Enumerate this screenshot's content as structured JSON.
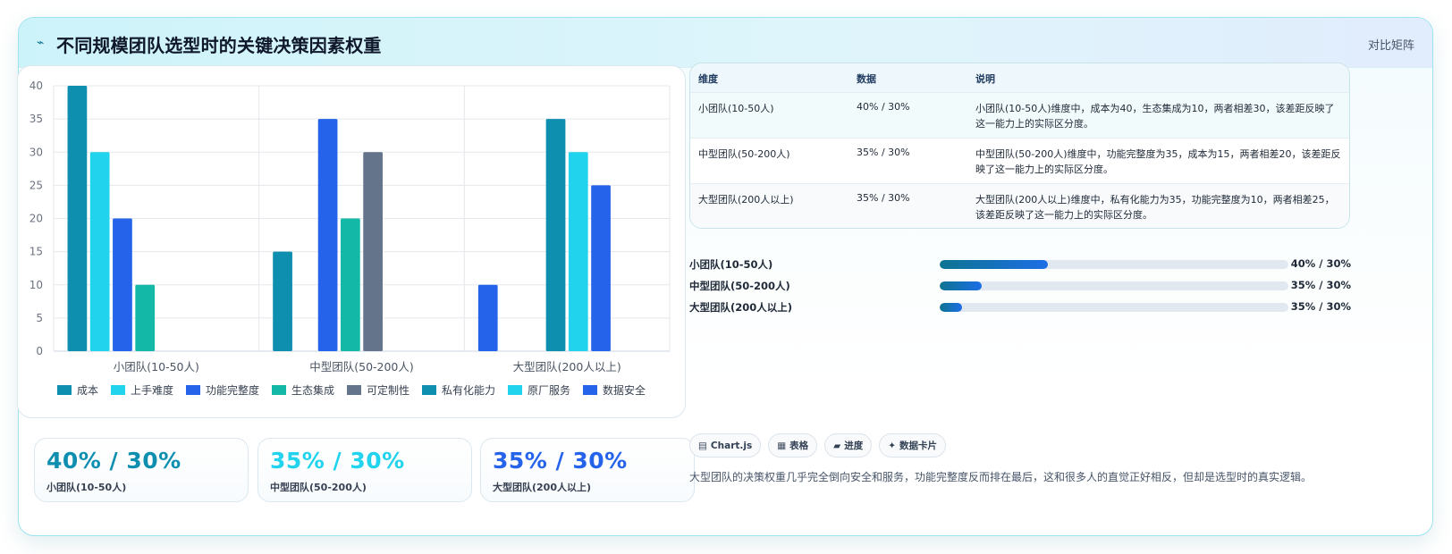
{
  "header": {
    "title": "不同规模团队选型时的关键决策因素权重",
    "tag": "对比矩阵",
    "icon": "bolt-icon"
  },
  "chart_data": {
    "type": "bar",
    "categories": [
      "小团队(10-50人)",
      "中型团队(50-200人)",
      "大型团队(200人以上)"
    ],
    "series": [
      {
        "name": "成本",
        "color": "#0e8fb0",
        "values": [
          40,
          15,
          null
        ]
      },
      {
        "name": "上手难度",
        "color": "#22d3ee",
        "values": [
          30,
          null,
          null
        ]
      },
      {
        "name": "功能完整度",
        "color": "#2563eb",
        "values": [
          20,
          35,
          10
        ]
      },
      {
        "name": "生态集成",
        "color": "#14b8a6",
        "values": [
          10,
          20,
          null
        ]
      },
      {
        "name": "可定制性",
        "color": "#64748b",
        "values": [
          null,
          30,
          null
        ]
      },
      {
        "name": "私有化能力",
        "color": "#0e8fb0",
        "values": [
          null,
          null,
          35
        ]
      },
      {
        "name": "原厂服务",
        "color": "#22d3ee",
        "values": [
          null,
          null,
          30
        ]
      },
      {
        "name": "数据安全",
        "color": "#2563eb",
        "values": [
          null,
          null,
          25
        ]
      }
    ],
    "ylim": [
      0,
      40
    ],
    "yticks": [
      0,
      5,
      10,
      15,
      20,
      25,
      30,
      35,
      40
    ],
    "grid": true,
    "legend": "bottom"
  },
  "stats": [
    {
      "value": "40% / 30%",
      "label": "小团队(10-50人)",
      "color": "#0e8fb0"
    },
    {
      "value": "35% / 30%",
      "label": "中型团队(50-200人)",
      "color": "#22d3ee"
    },
    {
      "value": "35% / 30%",
      "label": "大型团队(200人以上)",
      "color": "#2563eb"
    }
  ],
  "table": {
    "headers": [
      "维度",
      "数据",
      "说明"
    ],
    "rows": [
      {
        "dim": "小团队(10-50人)",
        "data": "40% / 30%",
        "desc": "小团队(10-50人)维度中，成本为40，生态集成为10，两者相差30，该差距反映了这一能力上的实际区分度。"
      },
      {
        "dim": "中型团队(50-200人)",
        "data": "35% / 30%",
        "desc": "中型团队(50-200人)维度中，功能完整度为35，成本为15，两者相差20，该差距反映了这一能力上的实际区分度。"
      },
      {
        "dim": "大型团队(200人以上)",
        "data": "35% / 30%",
        "desc": "大型团队(200人以上)维度中，私有化能力为35，功能完整度为10，两者相差25，该差距反映了这一能力上的实际区分度。"
      }
    ]
  },
  "progress": [
    {
      "label": "小团队(10-50人)",
      "value": "40% / 30%",
      "fraction": 0.31
    },
    {
      "label": "中型团队(50-200人)",
      "value": "35% / 30%",
      "fraction": 0.12
    },
    {
      "label": "大型团队(200人以上)",
      "value": "35% / 30%",
      "fraction": 0.065
    }
  ],
  "chips": [
    {
      "icon": "chart-icon",
      "glyph": "▤",
      "label": "Chart.js"
    },
    {
      "icon": "table-icon",
      "glyph": "▦",
      "label": "表格"
    },
    {
      "icon": "progress-icon",
      "glyph": "▰",
      "label": "进度"
    },
    {
      "icon": "sparkle-icon",
      "glyph": "✦",
      "label": "数据卡片"
    }
  ],
  "note": "大型团队的决策权重几乎完全倒向安全和服务，功能完整度反而排在最后，这和很多人的直觉正好相反，但却是选型时的真实逻辑。"
}
